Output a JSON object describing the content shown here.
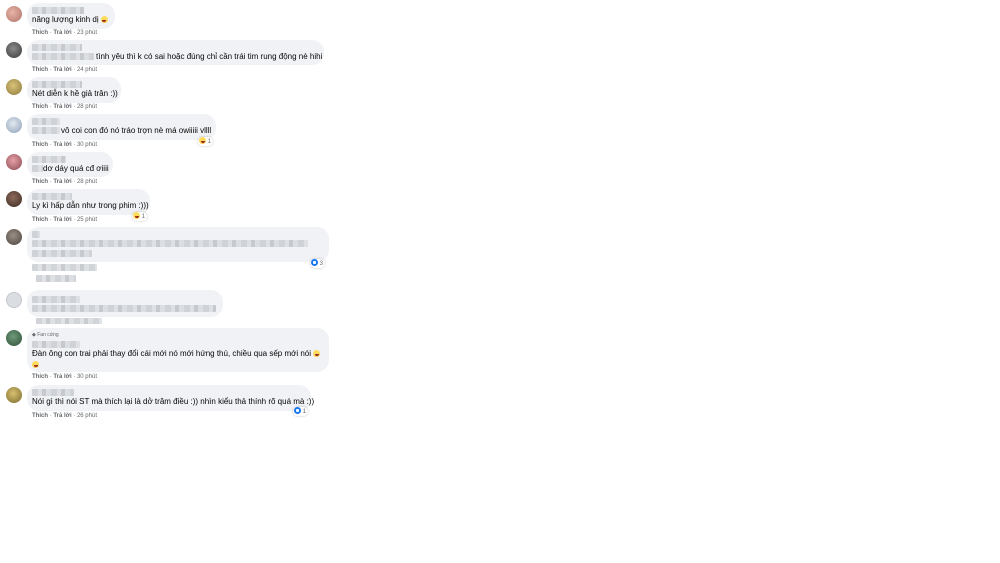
{
  "comments": [
    {
      "text": "năng lượng kinh dị",
      "like": "Thích",
      "reply": "Trả lời",
      "time": "23 phút"
    },
    {
      "text": "tình yêu thì k có sai hoặc đúng chỉ cần trái tim rung động nè hihi",
      "like": "Thích",
      "reply": "Trả lời",
      "time": "24 phút"
    },
    {
      "text": "Nét diễn k hề giả trân :))",
      "like": "Thích",
      "reply": "Trả lời",
      "time": "28 phút"
    },
    {
      "text": "vô coi con đó nó tráo trợn nè má owiiiii vllll",
      "like": "Thích",
      "reply": "Trả lời",
      "time": "30 phút",
      "reaction_count": "1"
    },
    {
      "text": "dơ dáy quá cđ ơiiii",
      "like": "Thích",
      "reply": "Trả lời",
      "time": "28 phút"
    },
    {
      "text": "Ly kì hấp dẫn như trong phim :)))",
      "like": "Thích",
      "reply": "Trả lời",
      "time": "25 phút",
      "reaction_count": "1"
    },
    {
      "reaction_count": "3"
    },
    {},
    {
      "badge": "Fan cứng",
      "text": "Đàn ông con trai phải thay đổi cái mới nó mới hứng thú, chiều qua sếp mới nói",
      "like": "Thích",
      "reply": "Trả lời",
      "time": "30 phút"
    },
    {
      "text": "Nói gì thì nói ST mà thích lại là dở trăm điều :)) nhìn kiểu thả thính rõ quá mà :))",
      "like": "Thích",
      "reply": "Trả lời",
      "time": "26 phút",
      "reaction_count": "1"
    }
  ],
  "colors": {
    "bubble": "#f0f2f5",
    "meta": "#65676b",
    "like_blue": "#1877f2"
  }
}
